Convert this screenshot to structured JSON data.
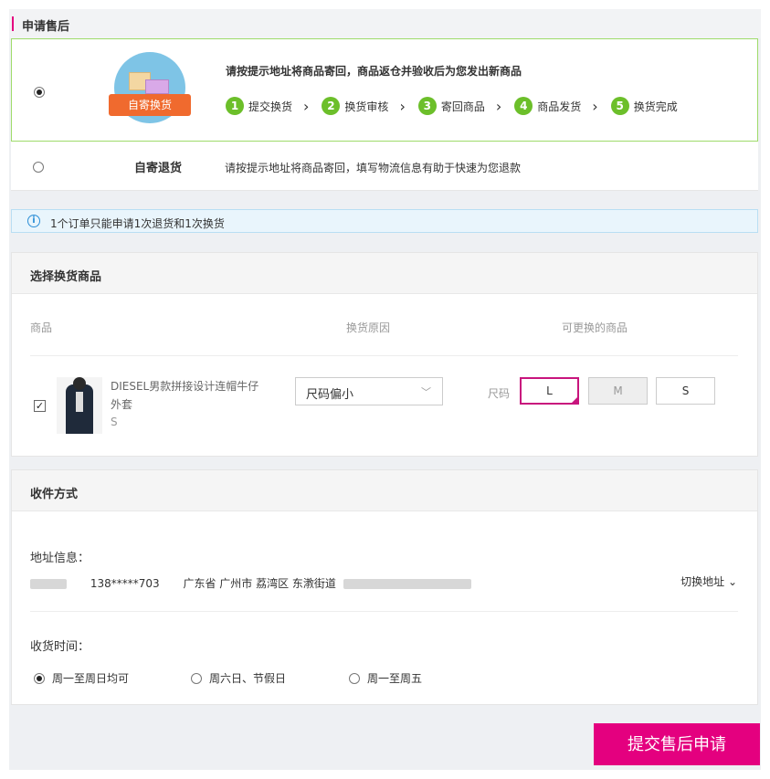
{
  "header": {
    "title": "申请售后"
  },
  "options": {
    "exchange": {
      "logo_text": "自寄换货",
      "description": "请按提示地址将商品寄回，商品返仓并验收后为您发出新商品",
      "selected": true,
      "steps": [
        {
          "num": "1",
          "label": "提交换货"
        },
        {
          "num": "2",
          "label": "换货审核"
        },
        {
          "num": "3",
          "label": "寄回商品"
        },
        {
          "num": "4",
          "label": "商品发货"
        },
        {
          "num": "5",
          "label": "换货完成"
        }
      ],
      "arrow": "›"
    },
    "return": {
      "label": "自寄退货",
      "description": "请按提示地址将商品寄回，填写物流信息有助于快速为您退款",
      "selected": false
    }
  },
  "info": {
    "icon": "info-icon",
    "text": "1个订单只能申请1次退货和1次换货"
  },
  "goods_section": {
    "title": "选择换货商品",
    "columns": [
      "商品",
      "换货原因",
      "可更换的商品"
    ],
    "item": {
      "checked": true,
      "name": "DIESEL男款拼接设计连帽牛仔外套",
      "size": "S",
      "reason": "尺码偏小",
      "size_label": "尺码",
      "sizes": [
        {
          "label": "L",
          "state": "selected"
        },
        {
          "label": "M",
          "state": "disabled"
        },
        {
          "label": "S",
          "state": "normal"
        }
      ]
    }
  },
  "receive_section": {
    "title": "收件方式",
    "address_label": "地址信息：",
    "phone": "138*****703",
    "address": "广东省 广州市 荔湾区 东漖街道",
    "switch_label": "切换地址",
    "time_label": "收货时间：",
    "time_options": [
      {
        "label": "周一至周日均可",
        "selected": true
      },
      {
        "label": "周六日、节假日",
        "selected": false
      },
      {
        "label": "周一至周五",
        "selected": false
      }
    ]
  },
  "submit_label": "提交售后申请",
  "colors": {
    "accent": "#e4007f",
    "step_green": "#6cbf2a",
    "info_blue": "#2b8ed6"
  }
}
